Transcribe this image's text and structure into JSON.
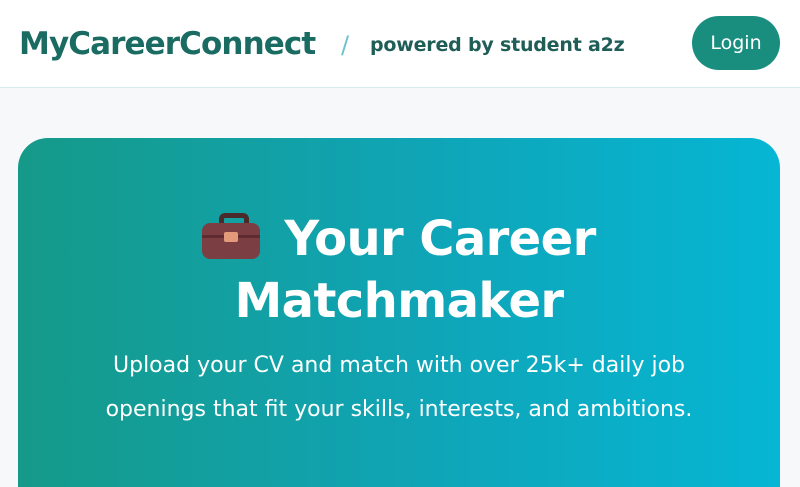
{
  "header": {
    "brand": "MyCareerConnect",
    "separator": "/",
    "tagline": "powered by student a2z",
    "login_label": "Login"
  },
  "hero": {
    "icon": "briefcase-icon",
    "title_line1": "Your Career",
    "title_line2": "Matchmaker",
    "subtitle_line1": "Upload your CV and match with over 25k+ daily job",
    "subtitle_line2": "openings that fit your skills, interests, and ambitions."
  },
  "colors": {
    "brand": "#1a6b62",
    "login_button": "#198e7f",
    "hero_gradient_start": "#159a89",
    "hero_gradient_end": "#06b6d4",
    "separator": "#6cc3cf"
  }
}
